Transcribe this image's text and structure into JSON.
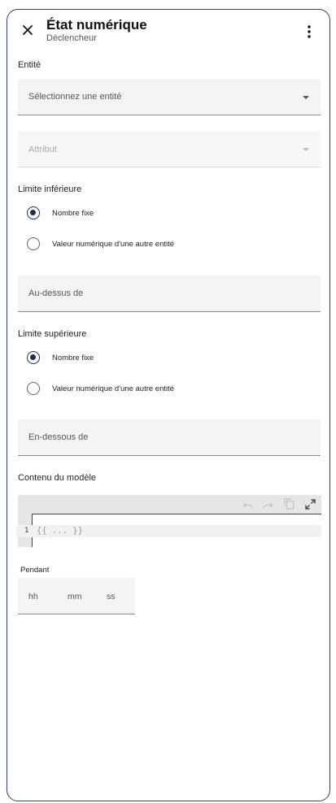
{
  "header": {
    "title": "État numérique",
    "subtitle": "Déclencheur",
    "close_icon": "close-icon",
    "more_icon": "more-vert-icon"
  },
  "entity": {
    "label": "Entité",
    "placeholder": "Sélectionnez une entité"
  },
  "attribute": {
    "placeholder": "Attribut",
    "disabled": true
  },
  "lower_limit": {
    "label": "Limite inférieure",
    "options": [
      {
        "label": "Nombre fixe",
        "checked": true
      },
      {
        "label": "Valeur numérique d'une autre entité",
        "checked": false
      }
    ],
    "input_placeholder": "Au-dessus de"
  },
  "upper_limit": {
    "label": "Limite supérieure",
    "options": [
      {
        "label": "Nombre fixe",
        "checked": true
      },
      {
        "label": "Valeur numérique d'une autre entité",
        "checked": false
      }
    ],
    "input_placeholder": "En-dessous de"
  },
  "template": {
    "label": "Contenu du modèle",
    "line_number": "1",
    "code_placeholder": "{{ ... }}",
    "toolbar_icons": [
      "undo-icon",
      "redo-icon",
      "copy-icon",
      "fullscreen-icon"
    ]
  },
  "duration": {
    "label": "Pendant",
    "hours_placeholder": "hh",
    "minutes_placeholder": "mm",
    "seconds_placeholder": "ss"
  },
  "colors": {
    "accent": "#1f2d57",
    "field_bg": "#f4f4f4",
    "border": "#30436e"
  }
}
